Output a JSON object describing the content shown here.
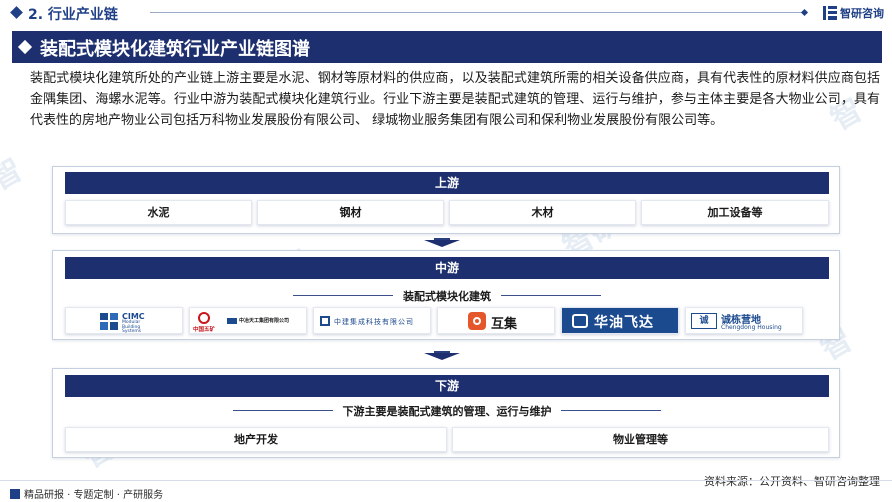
{
  "topbar": {
    "section_title": "2. 行业产业链",
    "brand_name": "智研咨询"
  },
  "header": {
    "title": "装配式模块化建筑行业产业链图谱"
  },
  "intro": {
    "text": "装配式模块化建筑所处的产业链上游主要是水泥、钢材等原材料的供应商，以及装配式建筑所需的相关设备供应商，具有代表性的原材料供应商包括金隅集团、海螺水泥等。行业中游为装配式模块化建筑行业。行业下游主要是装配式建筑的管理、运行与维护，参与主体主要是各大物业公司，具有代表性的房地产物业公司包括万科物业发展股份有限公司、 绿城物业服务集团有限公司和保利物业发展股份有限公司等。"
  },
  "upstream": {
    "label": "上游",
    "items": [
      "水泥",
      "钢材",
      "木材",
      "加工设备等"
    ]
  },
  "midstream": {
    "label": "中游",
    "subtitle": "装配式模块化建筑",
    "logos": [
      {
        "text": "CIMC",
        "sub": "Modular Building Systems",
        "icon": "cimc-logo"
      },
      {
        "text": "中国五矿",
        "sub": "中冶天工集团有限公司",
        "icon": "minmetals-logo"
      },
      {
        "text": "中建集成科技有限公司",
        "icon": "cscec-integration-logo"
      },
      {
        "text": "互集",
        "icon": "huji-logo"
      },
      {
        "text": "华油飞达",
        "icon": "huayou-feida-logo"
      },
      {
        "text": "诚栋营地",
        "sub": "Chengdong Housing",
        "icon": "chengdong-logo"
      }
    ]
  },
  "downstream": {
    "label": "下游",
    "subtitle": "下游主要是装配式建筑的管理、运行与维护",
    "items": [
      "地产开发",
      "物业管理等"
    ]
  },
  "footer": {
    "tagline": "精品研报 · 专题定制 · 产研服务",
    "source": "资料来源：公开资料、智研咨询整理"
  },
  "colors": {
    "navy": "#1d2f6e",
    "brand_blue": "#1f3f86",
    "huayou_blue": "#1b4a8f",
    "huji_orange": "#e5572a",
    "minmetals_red": "#c8161d"
  }
}
